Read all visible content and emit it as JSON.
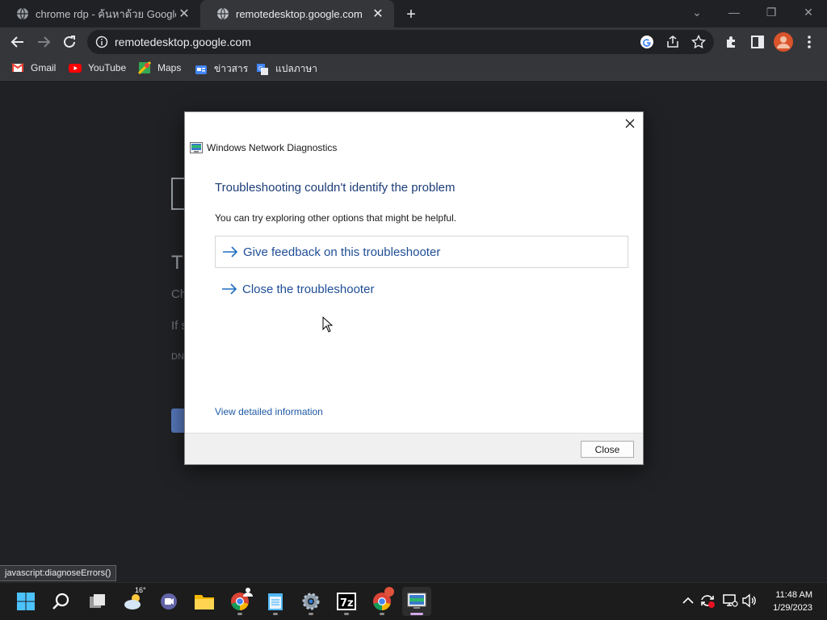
{
  "browser": {
    "tabs": [
      {
        "title": "chrome rdp - ค้นหาด้วย Google",
        "active": false
      },
      {
        "title": "remotedesktop.google.com",
        "active": true
      }
    ],
    "new_tab_label": "+",
    "url": "remotedesktop.google.com",
    "bookmarks": [
      {
        "label": "Gmail",
        "icon": "gmail-icon"
      },
      {
        "label": "YouTube",
        "icon": "youtube-icon"
      },
      {
        "label": "Maps",
        "icon": "maps-icon"
      },
      {
        "label": "ข่าวสาร",
        "icon": "news-icon"
      },
      {
        "label": "แปลภาษา",
        "icon": "translate-icon"
      }
    ],
    "status_bubble": "javascript:diagnoseErrors()"
  },
  "background_page": {
    "heading": "Th",
    "line1": "Ch",
    "line2": "If s",
    "line3": "DN"
  },
  "dialog": {
    "window_title": "Windows Network Diagnostics",
    "heading": "Troubleshooting couldn't identify the problem",
    "subtext": "You can try exploring other options that might be helpful.",
    "options": [
      {
        "label": "Give feedback on this troubleshooter"
      },
      {
        "label": "Close the troubleshooter"
      }
    ],
    "detail_link": "View detailed information",
    "close_button": "Close"
  },
  "taskbar": {
    "weather_temp": "16°",
    "time": "11:48 AM",
    "date": "1/29/2023"
  },
  "colors": {
    "dialog_heading": "#1c3d78",
    "option_link": "#1f4e96",
    "chrome_dark": "#202124",
    "chrome_toolbar": "#35363a"
  }
}
